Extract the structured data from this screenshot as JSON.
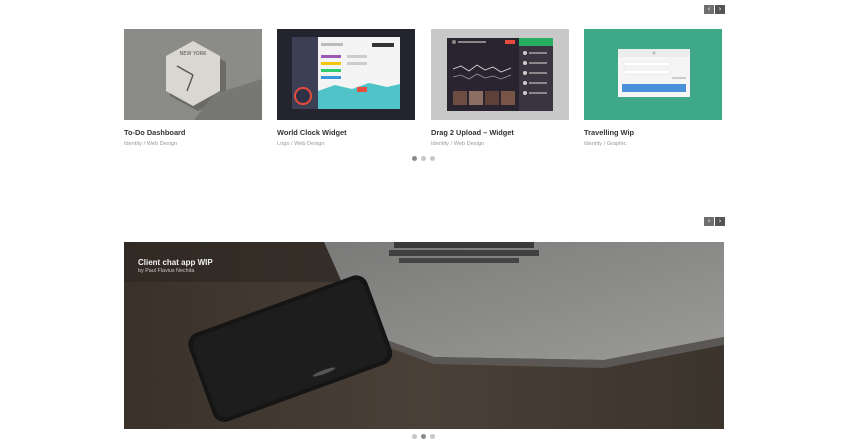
{
  "carousel_top": {
    "nav": {
      "prev_icon": "‹",
      "next_icon": "›"
    },
    "cards": [
      {
        "title": "To-Do Dashboard",
        "category": "Identity / Web Design",
        "thumb_text": "NEW YORK"
      },
      {
        "title": "World Clock Widget",
        "category": "Logo / Web Design",
        "thumb_text": ""
      },
      {
        "title": "Drag 2 Upload – Widget",
        "category": "Identity / Web Design",
        "thumb_text": ""
      },
      {
        "title": "Travelling Wip",
        "category": "Identity / Graphic",
        "thumb_text": ""
      }
    ],
    "dots_count": 3,
    "active_dot": 1
  },
  "carousel_bottom": {
    "nav": {
      "prev_icon": "‹",
      "next_icon": "›"
    },
    "slide": {
      "title": "Client chat app WIP",
      "author": "by Paul Flavius Nechita"
    },
    "dots_count": 3,
    "active_dot": 2
  },
  "colors": {
    "dot_active": "#8a8a8a",
    "dot_inactive": "#c7c7c7",
    "teal_thumb": "#3fa889"
  }
}
